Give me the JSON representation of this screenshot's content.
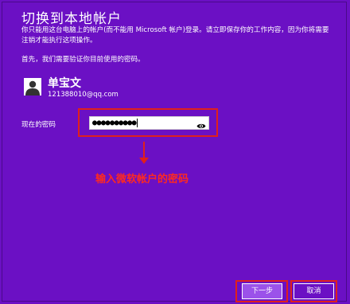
{
  "window": {
    "title": "切换到本地帐户",
    "description": "你只能用这台电脑上的帐户(而不能用 Microsoft 帐户)登录。请立即保存你的工作内容，因为你将需要注销才能执行这项操作。",
    "prompt": "首先，我们需要验证你目前使用的密码。"
  },
  "user": {
    "name": "单宝文",
    "email": "121388010@qq.com"
  },
  "password": {
    "label": "现在的密码",
    "masked_value": "●●●●●●●●●●"
  },
  "annotation": {
    "text": "输入微软帐户的密码",
    "color": "#e0201c"
  },
  "buttons": {
    "next": "下一步",
    "cancel": "取消"
  },
  "colors": {
    "background": "#6b10c4",
    "primary_button": "#9b52ea",
    "highlight": "#e0201c"
  }
}
